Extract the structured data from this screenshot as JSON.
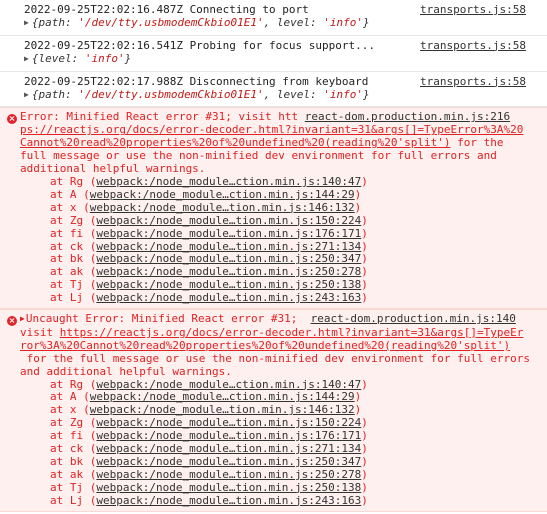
{
  "logs": [
    {
      "message": "2022-09-25T22:02:16.487Z Connecting to port",
      "source": "transports.js:58",
      "obj_pre": "{",
      "obj_parts": [
        {
          "k": "path",
          "v": "'/dev/tty.usbmodemCkbio01E1'"
        },
        {
          "k": "level",
          "v": "'info'"
        }
      ]
    },
    {
      "message": "2022-09-25T22:02:16.541Z Probing for focus support...",
      "source": "transports.js:58",
      "obj_parts": [
        {
          "k": "level",
          "v": "'info'"
        }
      ]
    },
    {
      "message": "2022-09-25T22:02:17.988Z Disconnecting from keyboard",
      "source": "transports.js:58",
      "obj_parts": [
        {
          "k": "path",
          "v": "'/dev/tty.usbmodemCkbio01E1'"
        },
        {
          "k": "level",
          "v": "'info'"
        }
      ]
    }
  ],
  "errors": [
    {
      "line1_text": "Error: Minified React error #31; visit htt",
      "line1_source": "react-dom.production.min.js:216",
      "body_lines": [
        {
          "text": "ps://reactjs.org/docs/error-decoder.html?invariant=31&args[]=TypeError%3A%20",
          "link": true
        },
        {
          "text": "Cannot%20read%20properties%20of%20undefined%20(reading%20'split')",
          "link": true,
          "after": " for the"
        },
        {
          "text": "full message or use the non-minified dev environment for full errors and",
          "link": false
        },
        {
          "text": "additional helpful warnings.",
          "link": false
        }
      ],
      "frames": [
        {
          "fn": "at Rg",
          "loc": "webpack:/node_module…ction.min.js:140:47"
        },
        {
          "fn": "at A",
          "loc": "webpack:/node_module…ction.min.js:144:29"
        },
        {
          "fn": "at x",
          "loc": "webpack:/node_module…tion.min.js:146:132"
        },
        {
          "fn": "at Zg",
          "loc": "webpack:/node_module…tion.min.js:150:224"
        },
        {
          "fn": "at fi",
          "loc": "webpack:/node_module…tion.min.js:176:171"
        },
        {
          "fn": "at ck",
          "loc": "webpack:/node_module…tion.min.js:271:134"
        },
        {
          "fn": "at bk",
          "loc": "webpack:/node_module…tion.min.js:250:347"
        },
        {
          "fn": "at ak",
          "loc": "webpack:/node_module…tion.min.js:250:278"
        },
        {
          "fn": "at Tj",
          "loc": "webpack:/node_module…tion.min.js:250:138"
        },
        {
          "fn": "at Lj",
          "loc": "webpack:/node_module…tion.min.js:243:163"
        }
      ]
    },
    {
      "line1_text": "Uncaught Error: Minified React error #31;",
      "line1_source": "react-dom.production.min.js:140",
      "body_lines": [
        {
          "text": "visit ",
          "link": false,
          "link_text": "https://reactjs.org/docs/error-decoder.html?invariant=31&args[]=TypeEr"
        },
        {
          "text": "ror%3A%20Cannot%20read%20properties%20of%20undefined%20(reading%20'split')",
          "link": true
        },
        {
          "text": " for the full message or use the non-minified dev environment for full errors",
          "link": false
        },
        {
          "text": "and additional helpful warnings.",
          "link": false
        }
      ],
      "frames": [
        {
          "fn": "at Rg",
          "loc": "webpack:/node_module…ction.min.js:140:47"
        },
        {
          "fn": "at A",
          "loc": "webpack:/node_module…ction.min.js:144:29"
        },
        {
          "fn": "at x",
          "loc": "webpack:/node_module…tion.min.js:146:132"
        },
        {
          "fn": "at Zg",
          "loc": "webpack:/node_module…tion.min.js:150:224"
        },
        {
          "fn": "at fi",
          "loc": "webpack:/node_module…tion.min.js:176:171"
        },
        {
          "fn": "at ck",
          "loc": "webpack:/node_module…tion.min.js:271:134"
        },
        {
          "fn": "at bk",
          "loc": "webpack:/node_module…tion.min.js:250:347"
        },
        {
          "fn": "at ak",
          "loc": "webpack:/node_module…tion.min.js:250:278"
        },
        {
          "fn": "at Tj",
          "loc": "webpack:/node_module…tion.min.js:250:138"
        },
        {
          "fn": "at Lj",
          "loc": "webpack:/node_module…tion.min.js:243:163"
        }
      ]
    }
  ],
  "colors": {
    "error_text": "#e02222",
    "error_bg": "#fef0ef",
    "string_value": "#c41a16"
  },
  "icons": {
    "expand": "triangle-right-icon",
    "error": "error-circle-icon"
  }
}
